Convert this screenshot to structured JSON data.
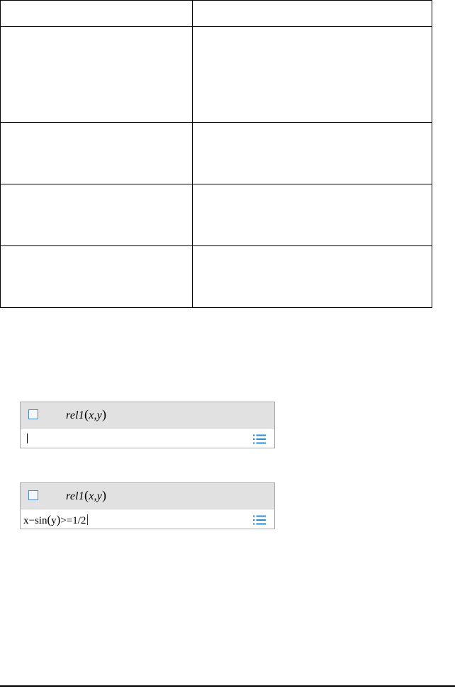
{
  "table": {
    "rows": [
      [
        "",
        ""
      ],
      [
        "",
        ""
      ],
      [
        "",
        ""
      ],
      [
        "",
        ""
      ],
      [
        "",
        ""
      ]
    ]
  },
  "widgets": [
    {
      "function_name": "rel1",
      "args": "x,y",
      "expression": ""
    },
    {
      "function_name": "rel1",
      "args": "x,y",
      "expression_parts": [
        "x−sin",
        "y",
        ">=1/2"
      ]
    }
  ],
  "icons": {
    "checkbox": "checkbox-icon",
    "list": "list-icon"
  },
  "colors": {
    "header_bg": "#e1e1e1",
    "checkbox_border": "#4d86c9",
    "list_icon": "#2a8bd0",
    "cursor_red": "#c00000"
  }
}
